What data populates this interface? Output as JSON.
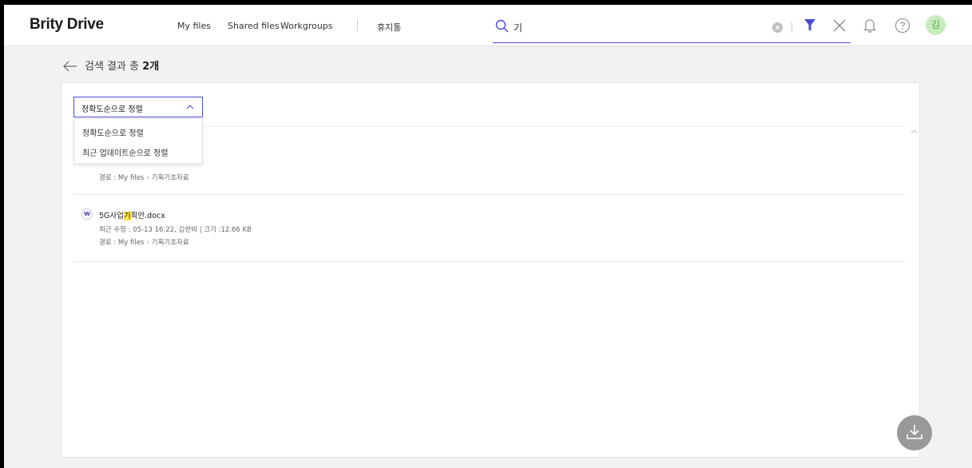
{
  "header": {
    "logo": "Brity Drive",
    "nav": [
      "My files",
      "Shared files",
      "Workgroups",
      "휴지통"
    ],
    "search_value": "기",
    "avatar_initial": "김",
    "accent_color": "#4b4bd4"
  },
  "results": {
    "prefix": "검색 결과 총 ",
    "count": "2개"
  },
  "sort": {
    "selected": "정확도순으로 정렬",
    "options": [
      "정확도순으로 정렬",
      "최근 업데이트순으로 정렬"
    ]
  },
  "files": [
    {
      "path_label": "경로 : ",
      "path_root": "My files",
      "path_sep": "›",
      "path_folder": "기획기초자료"
    },
    {
      "type_badge": "W",
      "name_before": "5G사업",
      "name_highlight": "기",
      "name_after": "획안.docx",
      "meta": "최근 수정 : 05-13 16:22, 김한비  |  크기 :12.66 KB",
      "path_label": "경로 : ",
      "path_root": "My files",
      "path_sep": "›",
      "path_folder": "기획기초자료"
    }
  ],
  "icons": {
    "search": "search-icon",
    "clear": "clear-icon",
    "filter": "filter-icon",
    "close": "close-icon",
    "bell": "bell-icon",
    "help": "help-icon",
    "back": "arrow-left-icon",
    "download": "download-icon"
  }
}
